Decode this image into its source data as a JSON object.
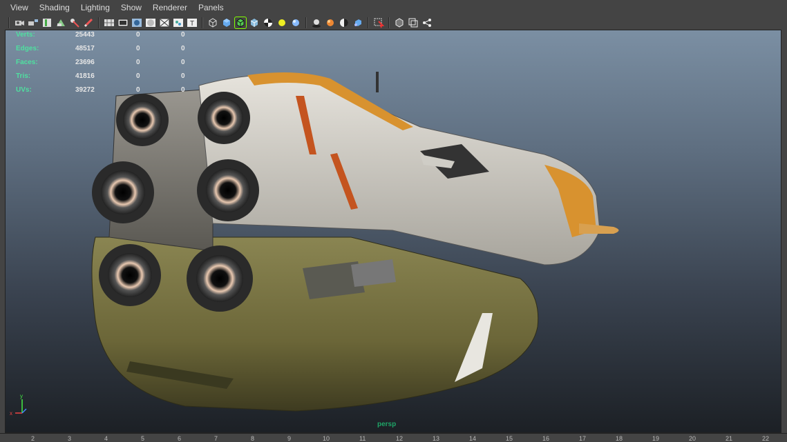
{
  "menu": {
    "items": [
      "View",
      "Shading",
      "Lighting",
      "Show",
      "Renderer",
      "Panels"
    ]
  },
  "toolbar": {
    "icons": [
      "camera-icon",
      "camera-attrib-icon",
      "bookmark-icon",
      "image-plane-icon",
      "2d-pan-icon",
      "grease-pencil-icon",
      "grid-icon",
      "film-gate-icon",
      "resolution-gate-icon",
      "gate-mask-icon",
      "field-chart-icon",
      "safe-action-icon",
      "safe-title-icon",
      "wireframe-icon",
      "smooth-shade-icon",
      "wireframe-on-shaded-icon",
      "textured-icon",
      "checker-icon",
      "use-default-light-icon",
      "all-lights-icon",
      "shadows-icon",
      "screen-ao-icon",
      "motion-blur-icon",
      "anti-alias-icon",
      "isolate-select-icon",
      "xray-icon",
      "xray-joints-icon",
      "hud-icon"
    ]
  },
  "hud": {
    "rows": [
      {
        "label": "Verts:",
        "v1": "25443",
        "v2": "0",
        "v3": "0"
      },
      {
        "label": "Edges:",
        "v1": "48517",
        "v2": "0",
        "v3": "0"
      },
      {
        "label": "Faces:",
        "v1": "23696",
        "v2": "0",
        "v3": "0"
      },
      {
        "label": "Tris:",
        "v1": "41816",
        "v2": "0",
        "v3": "0"
      },
      {
        "label": "UVs:",
        "v1": "39272",
        "v2": "0",
        "v3": "0"
      }
    ]
  },
  "viewport": {
    "camera_label": "persp",
    "axis": {
      "x": "x",
      "y": "y"
    }
  },
  "ruler": {
    "ticks": [
      "2",
      "3",
      "4",
      "5",
      "6",
      "7",
      "8",
      "9",
      "10",
      "11",
      "12",
      "13",
      "14",
      "15",
      "16",
      "17",
      "18",
      "19",
      "20",
      "21",
      "22"
    ]
  },
  "colors": {
    "hud_label": "#4fe0a0",
    "camera_label": "#1ea567",
    "ship_hull_olive": "#6e6a3a",
    "ship_hull_white": "#d6d3cb",
    "ship_accent_orange": "#d8922f"
  }
}
